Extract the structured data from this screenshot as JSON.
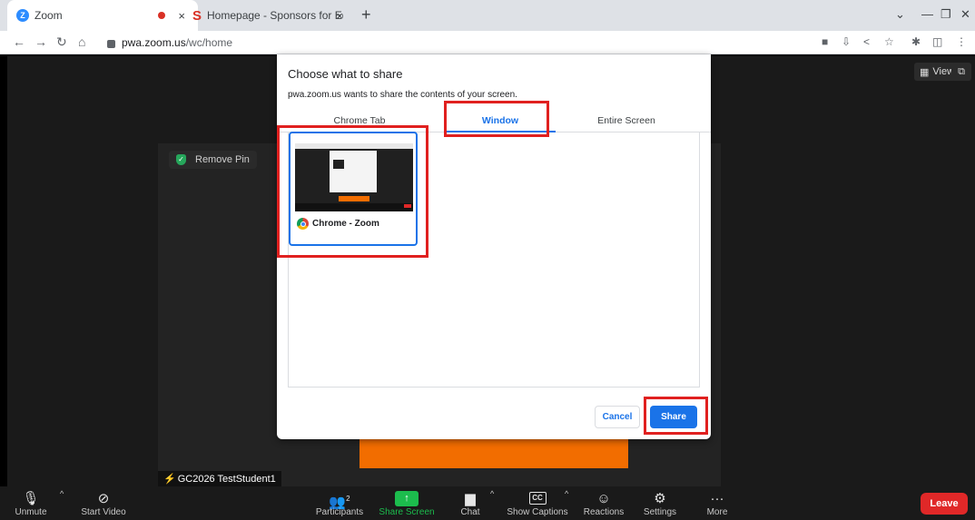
{
  "browser": {
    "tabs": [
      {
        "title": "Zoom",
        "icon": "zoom-icon",
        "recording": true
      },
      {
        "title": "Homepage - Sponsors for Educa",
        "icon": "sponsors-s-icon"
      }
    ],
    "close_glyph": "×",
    "new_tab_glyph": "+",
    "url_host": "pwa.zoom.us",
    "url_path": "/wc/home"
  },
  "meeting": {
    "remove_pin": "Remove Pin",
    "participant_name": "GC2026 TestStudent1",
    "view_label": "View",
    "controls": {
      "unmute": "Unmute",
      "start_video": "Start Video",
      "participants": "Participants",
      "participants_count": "2",
      "share_screen": "Share Screen",
      "chat": "Chat",
      "show_captions": "Show Captions",
      "cc": "CC",
      "reactions": "Reactions",
      "settings": "Settings",
      "more": "More",
      "leave": "Leave"
    }
  },
  "dialog": {
    "title": "Choose what to share",
    "subtitle": "pwa.zoom.us wants to share the contents of your screen.",
    "tabs": [
      "Chrome Tab",
      "Window",
      "Entire Screen"
    ],
    "selected_tab": "Window",
    "window_item": "Chrome - Zoom",
    "cancel": "Cancel",
    "share": "Share"
  },
  "colors": {
    "accent_blue": "#1a73e8",
    "annotation_red": "#e0201f",
    "share_green": "#1cbc4d",
    "leave_red": "#e02828",
    "orange": "#f26d00"
  }
}
